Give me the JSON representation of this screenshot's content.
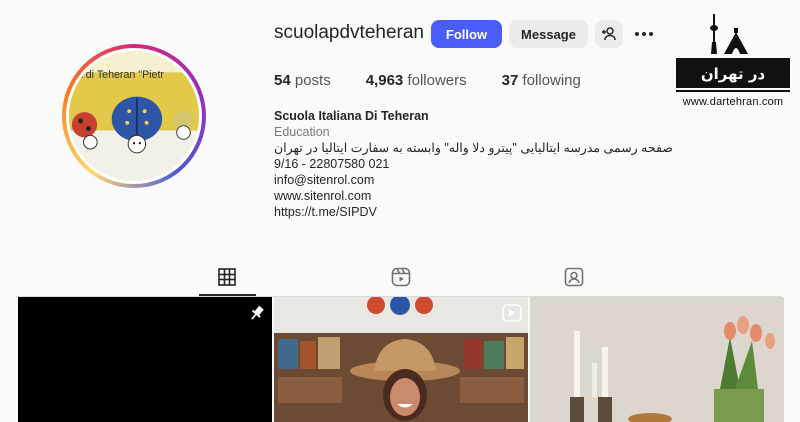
{
  "profile": {
    "username": "scuolapdvteheran",
    "follow_label": "Follow",
    "message_label": "Message",
    "add_user_icon": "add-user-icon",
    "more_icon": "more-icon",
    "avatar_text": "na di Teheran \"Pietr"
  },
  "stats": {
    "posts_count": "54",
    "posts_label": "posts",
    "followers_count": "4,963",
    "followers_label": "followers",
    "following_count": "37",
    "following_label": "following"
  },
  "bio": {
    "name": "Scuola Italiana Di Teheran",
    "category": "Education",
    "persian_line": "صفحه رسمی مدرسه ایتالیایی \"پیترو دلا واله\" وابسته به سفارت ایتالیا در تهران",
    "phone": "9/16 - 22807580 021",
    "email": "info@sitenrol.com",
    "website": "www.sitenrol.com",
    "telegram": "https://t.me/SIPDV"
  },
  "watermark": {
    "logo_text": "در تهران",
    "url": "www.dartehran.com"
  },
  "tabs": [
    {
      "name": "posts",
      "icon": "grid-icon",
      "active": true
    },
    {
      "name": "reels",
      "icon": "reels-icon",
      "active": false
    },
    {
      "name": "tagged",
      "icon": "tagged-icon",
      "active": false
    }
  ],
  "grid": [
    {
      "kind": "photo",
      "pinned": true,
      "icon": "pin-icon"
    },
    {
      "kind": "reel",
      "icon": "reel-icon"
    },
    {
      "kind": "photo"
    }
  ],
  "colors": {
    "accent": "#4a5df9",
    "text": "#262626",
    "muted": "#7a7a7a",
    "button_bg": "#ececec"
  }
}
